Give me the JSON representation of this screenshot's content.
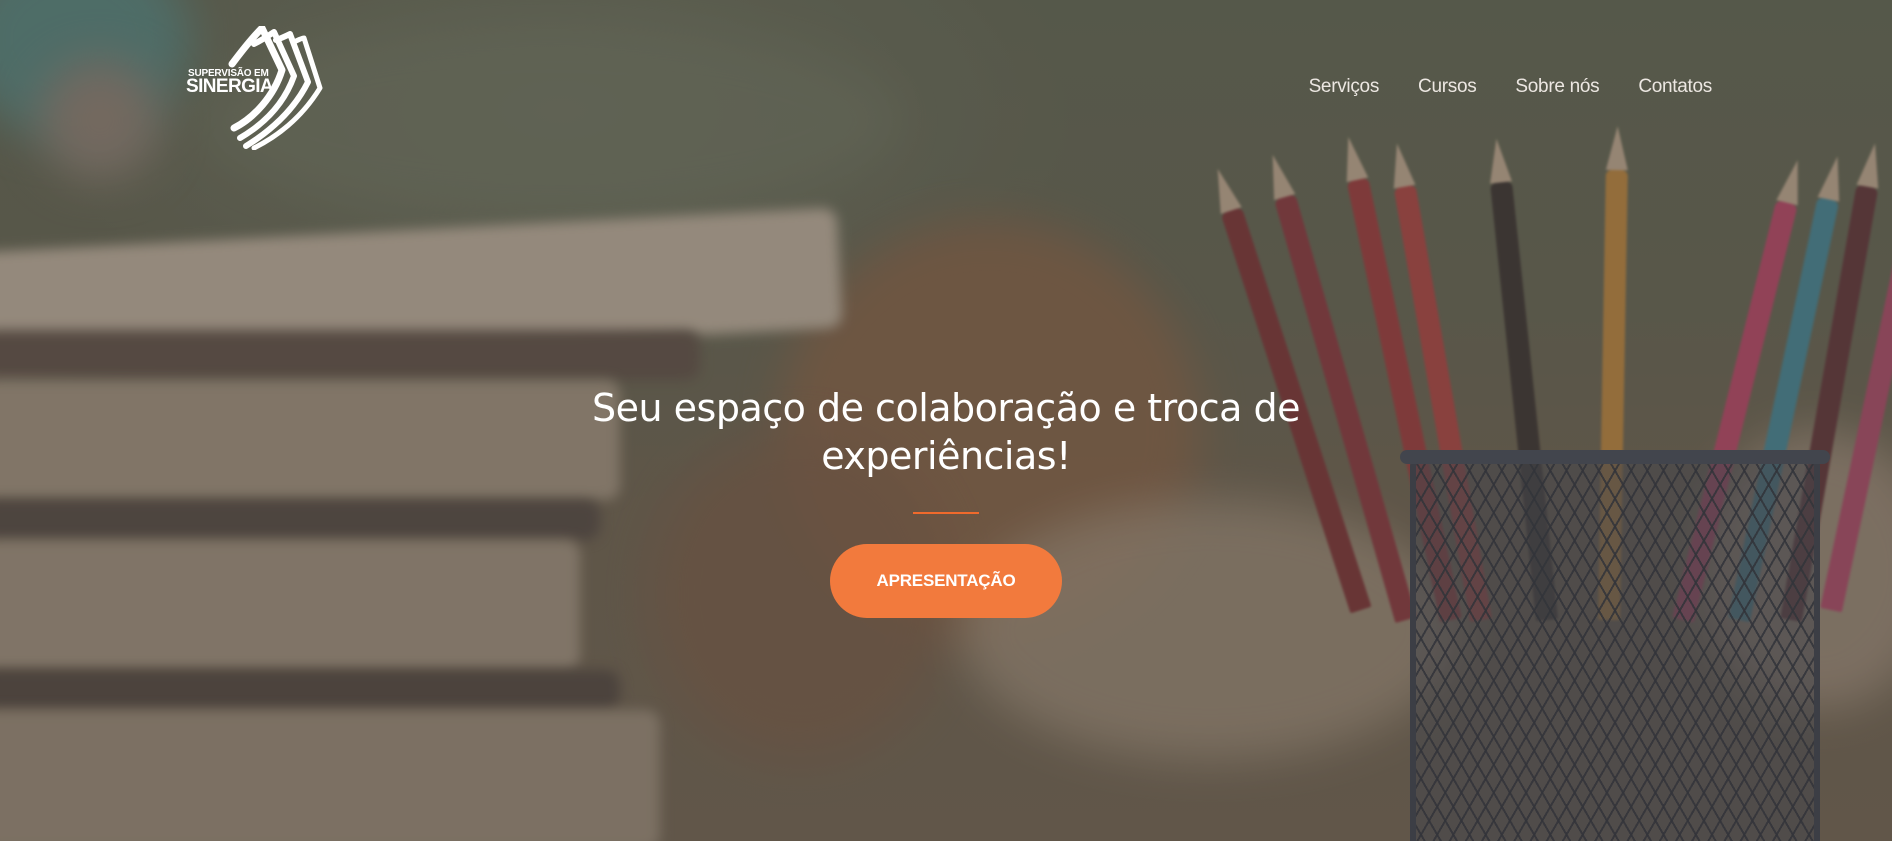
{
  "logo": {
    "line1": "SUPERVISÃO EM",
    "line2": "SINERGIA",
    "icon": "open-book-pages-icon"
  },
  "nav": {
    "items": [
      {
        "label": "Serviços"
      },
      {
        "label": "Cursos"
      },
      {
        "label": "Sobre nós"
      },
      {
        "label": "Contatos"
      }
    ]
  },
  "hero": {
    "title": "Seu espaço de colaboração e troca de experiências!",
    "button_label": "APRESENTAÇÃO"
  },
  "colors": {
    "accent": "#f27a3d",
    "divider": "#f06a2c",
    "text": "#ffffff"
  }
}
